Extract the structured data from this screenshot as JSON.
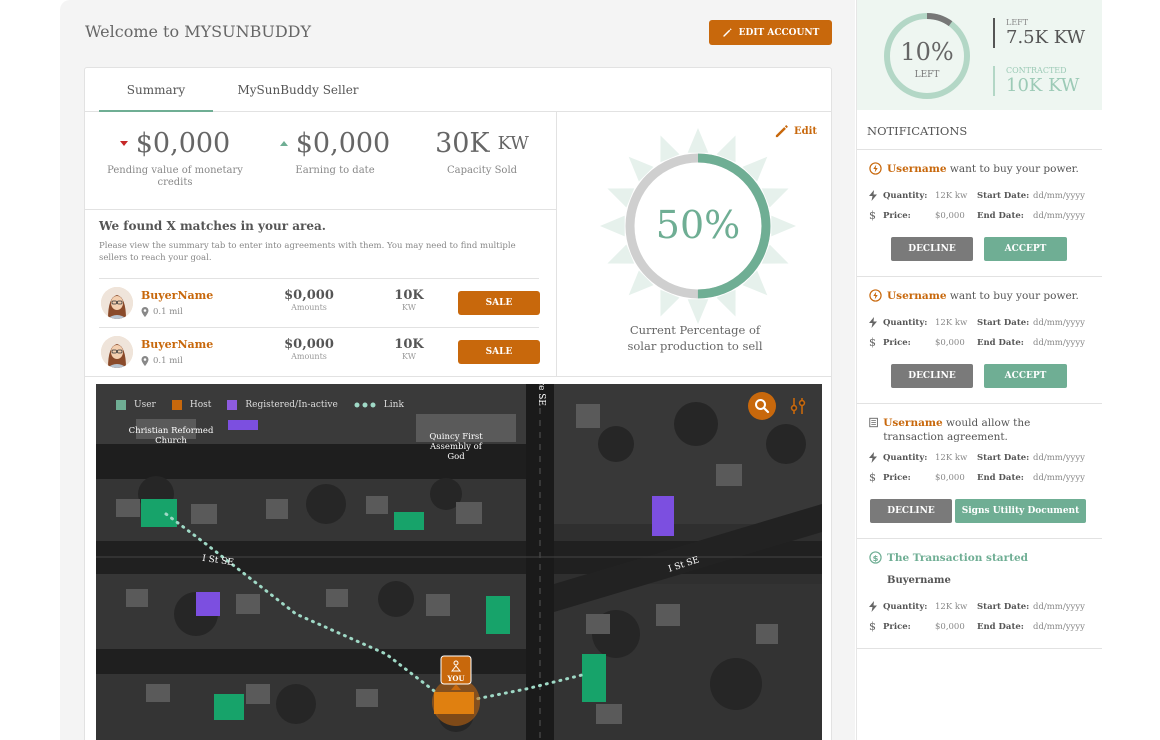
{
  "header": {
    "title": "Welcome to MYSUNBUDDY",
    "edit_account": "EDIT ACCOUNT"
  },
  "tabs": [
    {
      "label": "Summary"
    },
    {
      "label": "MySunBuddy Seller"
    }
  ],
  "stats": [
    {
      "value": "$0,000",
      "unit": "",
      "label": "Pending value of monetary credits",
      "trend": "down"
    },
    {
      "value": "$0,000",
      "unit": "",
      "label": "Earning to date",
      "trend": "up"
    },
    {
      "value": "30K",
      "unit": "KW",
      "label": "Capacity Sold",
      "trend": ""
    }
  ],
  "matches": {
    "title": "We found X matches in your area.",
    "description": "Please view the summary tab to enter into agreements with them. You may need to find multiple sellers to reach your goal.",
    "rows": [
      {
        "name": "BuyerName",
        "distance": "0.1 mil",
        "amount": "$0,000",
        "amount_label": "Amounts",
        "kw": "10K",
        "kw_label": "KW",
        "action": "SALE"
      },
      {
        "name": "BuyerName",
        "distance": "0.1 mil",
        "amount": "$0,000",
        "amount_label": "Amounts",
        "kw": "10K",
        "kw_label": "KW",
        "action": "SALE"
      }
    ]
  },
  "gauge": {
    "edit_label": "Edit",
    "percent": 50,
    "percent_text": "50%",
    "caption": "Current Percentage of solar production to sell"
  },
  "map": {
    "legend": [
      {
        "label": "User",
        "color": "#6fae94"
      },
      {
        "label": "Host",
        "color": "#c8680c"
      },
      {
        "label": "Registered/In-active",
        "color": "#8e5be0"
      },
      {
        "label": "Link",
        "color": "#9fd9c6"
      }
    ],
    "places": [
      "Christian Reformed Church",
      "Quincy First Assembly of God"
    ],
    "roads": [
      "I St SE",
      "I St SE",
      "ve SE"
    ],
    "you_label": "YOU"
  },
  "summary": {
    "ring_percent": 10,
    "ring_text": "10%",
    "ring_label": "LEFT",
    "left_label": "LEFT",
    "left_value": "7.5K KW",
    "contracted_label": "CONTRACTED",
    "contracted_value": "10K KW"
  },
  "notifications": {
    "title": "NOTIFICATIONS",
    "items": [
      {
        "user": "Username",
        "text": "want to buy your power.",
        "quantity_label": "Quantity:",
        "quantity": "12K kw",
        "start_label": "Start Date:",
        "start": "dd/mm/yyyy",
        "price_label": "Price:",
        "price": "$0,000",
        "end_label": "End Date:",
        "end": "dd/mm/yyyy",
        "decline": "DECLINE",
        "accept": "ACCEPT"
      },
      {
        "user": "Username",
        "text": "want to buy your power.",
        "quantity_label": "Quantity:",
        "quantity": "12K kw",
        "start_label": "Start Date:",
        "start": "dd/mm/yyyy",
        "price_label": "Price:",
        "price": "$0,000",
        "end_label": "End Date:",
        "end": "dd/mm/yyyy",
        "decline": "DECLINE",
        "accept": "ACCEPT"
      },
      {
        "user": "Username",
        "text": "would allow the transaction agreement.",
        "quantity_label": "Quantity:",
        "quantity": "12K kw",
        "start_label": "Start Date:",
        "start": "dd/mm/yyyy",
        "price_label": "Price:",
        "price": "$0,000",
        "end_label": "End Date:",
        "end": "dd/mm/yyyy",
        "decline": "DECLINE",
        "accept": "Signs Utility Document"
      },
      {
        "title": "The Transaction started",
        "buyer": "Buyername",
        "quantity_label": "Quantity:",
        "quantity": "12K kw",
        "start_label": "Start Date:",
        "start": "dd/mm/yyyy",
        "price_label": "Price:",
        "price": "$0,000",
        "end_label": "End Date:",
        "end": "dd/mm/yyyy"
      }
    ]
  },
  "colors": {
    "accent": "#c8680c",
    "green": "#6fae94",
    "purple": "#8e5be0"
  }
}
